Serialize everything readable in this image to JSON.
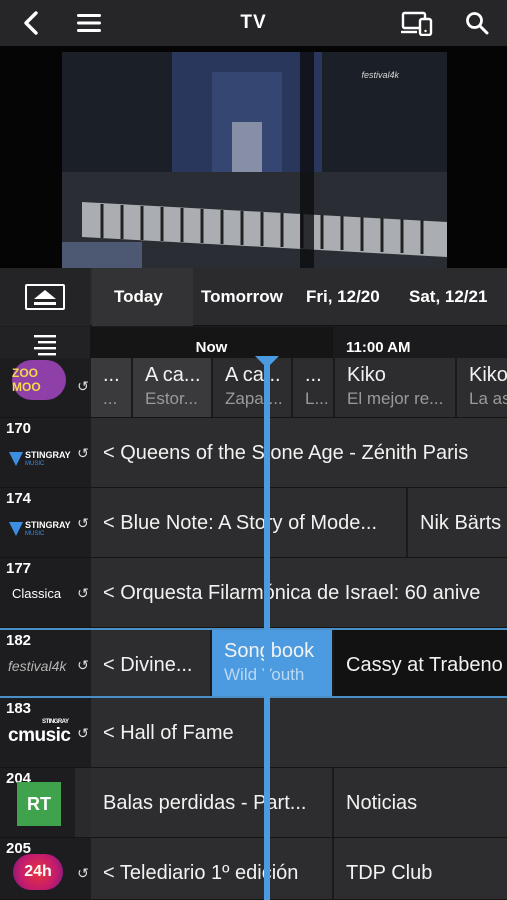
{
  "header": {
    "title": "TV"
  },
  "video": {
    "channel_logo": "festival4k"
  },
  "date_tabs": [
    "Today",
    "Tomorrow",
    "Fri, 12/20",
    "Sat, 12/21"
  ],
  "timeline": {
    "now_label": "Now",
    "next_label": "11:00 AM"
  },
  "channels": [
    {
      "number": "",
      "logo": "ZOO MOO",
      "programs": [
        {
          "title": "...",
          "subtitle": "..."
        },
        {
          "title": "A ca...",
          "subtitle": "Estor..."
        },
        {
          "title": "A ca...",
          "subtitle": "Zapat..."
        },
        {
          "title": "...",
          "subtitle": "L..."
        },
        {
          "title": "Kiko",
          "subtitle": "El mejor re..."
        },
        {
          "title": "Kiko",
          "subtitle": "La as"
        }
      ]
    },
    {
      "number": "170",
      "logo": "STINGRAY",
      "logo_sub": "MUSIC",
      "programs": [
        {
          "title": "< Queens of the Stone Age - Zénith Paris"
        }
      ]
    },
    {
      "number": "174",
      "logo": "STINGRAY",
      "logo_sub": "MUSIC",
      "programs": [
        {
          "title": "< Blue Note: A Story of Mode..."
        },
        {
          "title": "Nik Bärts"
        }
      ]
    },
    {
      "number": "177",
      "logo": "Classica",
      "programs": [
        {
          "title": "< Orquesta Filarmónica de Israel: 60 anive"
        }
      ]
    },
    {
      "number": "182",
      "logo": "festival4k",
      "programs": [
        {
          "title": "< Divine..."
        },
        {
          "title": "Songbook",
          "subtitle": "Wild Youth"
        },
        {
          "title": "Cassy at Trabeno"
        }
      ]
    },
    {
      "number": "183",
      "logo": "cmusic",
      "logo_sub": "STINGRAY",
      "programs": [
        {
          "title": "< Hall of Fame"
        }
      ]
    },
    {
      "number": "204",
      "logo": "RT",
      "programs": [
        {
          "title": "Balas perdidas - Part..."
        },
        {
          "title": "Noticias"
        }
      ]
    },
    {
      "number": "205",
      "logo": "24h",
      "programs": [
        {
          "title": "< Telediario 1º edición"
        },
        {
          "title": "TDP Club"
        }
      ]
    }
  ],
  "colors": {
    "accent": "#4c9be0",
    "background": "#1c1c1e"
  }
}
